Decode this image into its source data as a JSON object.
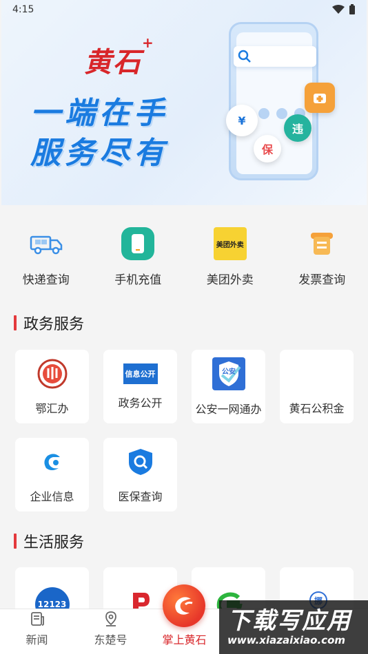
{
  "status_bar": {
    "time": "4:15"
  },
  "banner": {
    "logo_text": "黄石",
    "logo_plus": "+",
    "line1": "一端在手",
    "line2": "服务尽有",
    "bubble_yen": "¥",
    "bubble_wei": "违",
    "bubble_bao": "保"
  },
  "quick_actions": [
    {
      "label": "快递查询",
      "icon": "delivery-truck-icon"
    },
    {
      "label": "手机充值",
      "icon": "phone-recharge-icon"
    },
    {
      "label": "美团外卖",
      "icon": "meituan-waimai-icon",
      "icon_text": "美团外卖"
    },
    {
      "label": "发票查询",
      "icon": "invoice-icon"
    }
  ],
  "gov_section": {
    "title": "政务服务",
    "items": [
      {
        "label": "鄂汇办",
        "icon": "ehuiban-icon"
      },
      {
        "label": "政务公开",
        "icon": "gov-info-icon",
        "icon_text": "信息公开"
      },
      {
        "label": "公安一网通办",
        "icon": "police-icon",
        "icon_text": "公安"
      },
      {
        "label": "黄石公积金",
        "icon": "housing-fund-icon"
      },
      {
        "label": "企业信息",
        "icon": "enterprise-info-icon"
      },
      {
        "label": "医保查询",
        "icon": "medical-insurance-icon"
      }
    ]
  },
  "life_section": {
    "title": "生活服务",
    "items": [
      {
        "label": "",
        "icon": "traffic-12123-icon",
        "icon_text": "12123"
      },
      {
        "label": "",
        "icon": "parking-icon"
      },
      {
        "label": "",
        "icon": "green-g-icon"
      },
      {
        "label": "",
        "icon": "move-car-icon",
        "icon_text": "挪"
      }
    ]
  },
  "tabbar": {
    "tabs": [
      {
        "label": "新闻",
        "icon": "news-icon"
      },
      {
        "label": "东楚号",
        "icon": "location-pin-icon"
      },
      {
        "label": "掌上黄石",
        "icon": "home-logo-icon"
      }
    ]
  },
  "watermark": {
    "title": "下载写应用",
    "url": "www.xiazaixiao.com"
  },
  "colors": {
    "accent": "#d8262a",
    "banner_blue": "#1a7be0",
    "section_bar": "#e4393c"
  }
}
